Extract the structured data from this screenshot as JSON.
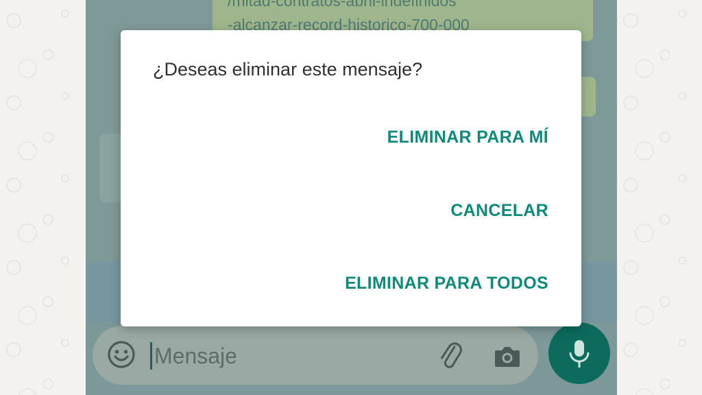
{
  "chat": {
    "link_line_1": "/mitad-contratos-abril-indefinidos",
    "link_line_2": "-alcanzar-record-historico-700-000"
  },
  "dialog": {
    "title": "¿Deseas eliminar este mensaje?",
    "delete_for_me_label": "ELIMINAR PARA MÍ",
    "cancel_label": "CANCELAR",
    "delete_for_all_label": "ELIMINAR PARA TODOS"
  },
  "composer": {
    "placeholder": "Mensaje"
  },
  "icons": {
    "emoji": "emoji-icon",
    "attach": "paperclip-icon",
    "camera": "camera-icon",
    "mic": "microphone-icon"
  },
  "colors": {
    "accent": "#0f8a78",
    "mic_button": "#0d6b5e",
    "dialog_background": "#ffffff"
  }
}
